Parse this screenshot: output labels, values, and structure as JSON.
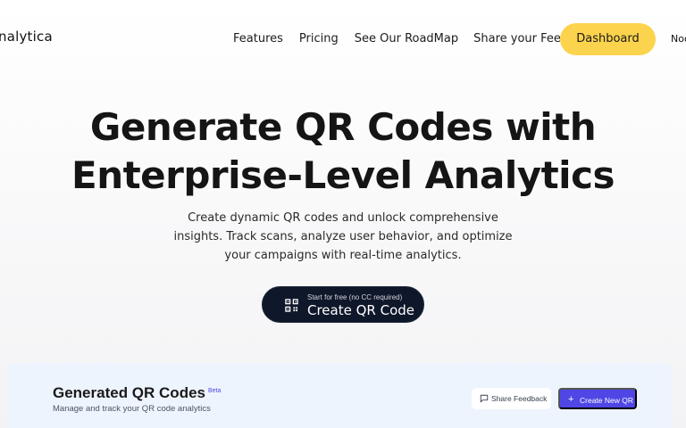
{
  "nav": {
    "brand": "nalytica",
    "links": [
      "Features",
      "Pricing",
      "See Our RoadMap",
      "Share your Feedback"
    ],
    "dashboard_label": "Dashboard",
    "user_label": "Noo"
  },
  "hero": {
    "title_line1": "Generate QR Codes with",
    "title_line2": "Enterprise-Level Analytics",
    "subtitle": "Create dynamic QR codes and unlock comprehensive insights. Track scans, analyze user behavior, and optimize your campaigns with real-time analytics.",
    "cta_small": "Start for free (no CC required)",
    "cta_label": "Create QR Code",
    "cta_icon": "qr-code-icon"
  },
  "panel": {
    "title": "Generated QR Codes",
    "badge": "Beta",
    "subtitle": "Manage and track your QR code analytics",
    "feedback_label": "Share Feedback",
    "feedback_icon": "message-square-icon",
    "create_label": "Create New QR",
    "create_icon": "plus-icon"
  },
  "colors": {
    "accent_yellow": "#fcd34d",
    "cta_dark": "#0f172a",
    "primary_indigo": "#4f46e5",
    "panel_bg": "#eef4fd"
  }
}
